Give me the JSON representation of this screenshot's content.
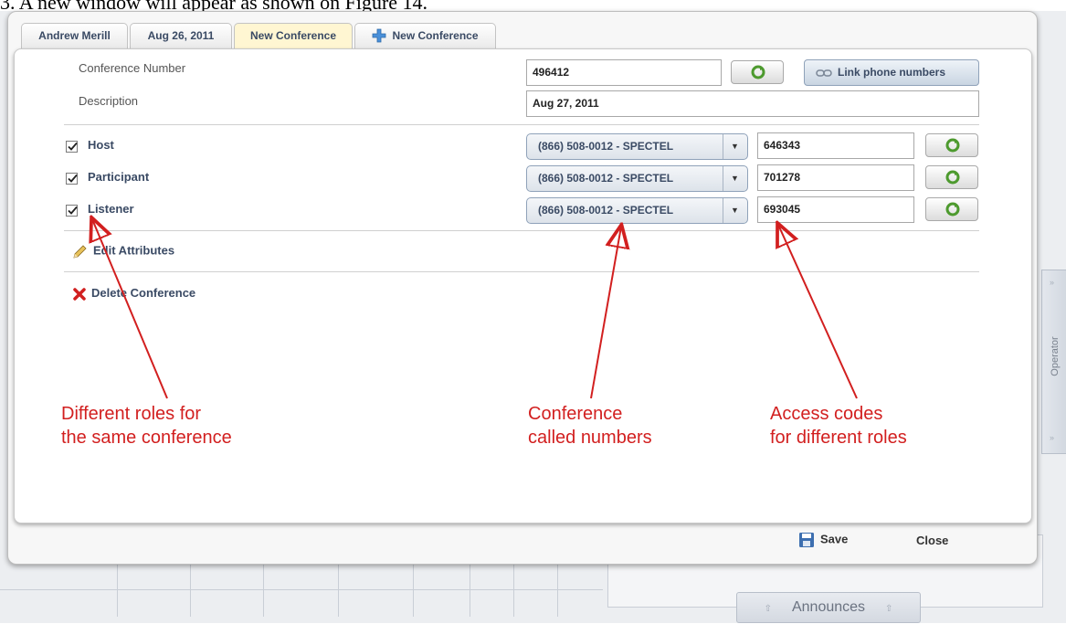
{
  "document": {
    "heading": "3.  A new window will appear as shown on Figure 14."
  },
  "tabs": [
    {
      "label": "Andrew Merill"
    },
    {
      "label": "Aug 26, 2011"
    },
    {
      "label": "New Conference"
    },
    {
      "label": "New Conference",
      "icon": "plus-icon"
    }
  ],
  "form": {
    "conference_number_label": "Conference Number",
    "conference_number_value": "496412",
    "description_label": "Description",
    "description_value": "Aug 27, 2011",
    "link_button_label": "Link phone numbers",
    "link_icon": "link-icon",
    "refresh_icon": "refresh-icon"
  },
  "roles": [
    {
      "label": "Host",
      "checked": true,
      "phone": "(866) 508-0012 - SPECTEL",
      "access_code": "646343"
    },
    {
      "label": "Participant",
      "checked": true,
      "phone": "(866) 508-0012 - SPECTEL",
      "access_code": "701278"
    },
    {
      "label": "Listener",
      "checked": true,
      "phone": "(866) 508-0012 - SPECTEL",
      "access_code": "693045"
    }
  ],
  "actions": {
    "edit_attributes": "Edit Attributes",
    "edit_icon": "pencil-icon",
    "delete_conference": "Delete Conference",
    "delete_icon": "red-x-icon"
  },
  "annotations": {
    "roles_line1": "Different roles for",
    "roles_line2": "the same conference",
    "numbers_line1": "Conference",
    "numbers_line2": "called numbers",
    "codes_line1": "Access codes",
    "codes_line2": "for different roles",
    "color": "#d21f1f"
  },
  "footer": {
    "save_label": "Save",
    "save_icon": "floppy-disk-icon",
    "close_label": "Close"
  },
  "background": {
    "operator_tab_label": "Operator",
    "announces_tab_label": "Announces"
  }
}
